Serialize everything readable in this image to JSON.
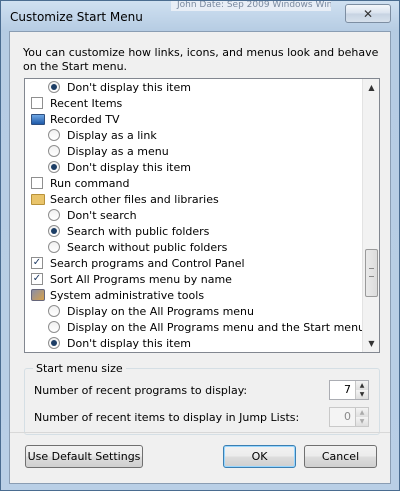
{
  "window": {
    "title": "Customize Start Menu",
    "close_glyph": "✕",
    "background_text": "John Date: Sep 2009    Windows Windows 7"
  },
  "intro": "You can customize how links, icons, and menus look and behave on the Start menu.",
  "options": [
    {
      "type": "radio",
      "label": "Don't display this item",
      "checked": true,
      "indent": 1
    },
    {
      "type": "checkbox",
      "label": "Recent Items",
      "checked": false,
      "indent": 0
    },
    {
      "type": "header",
      "label": "Recorded TV",
      "icon": "tv-icon",
      "indent": 0
    },
    {
      "type": "radio",
      "label": "Display as a link",
      "checked": false,
      "indent": 1
    },
    {
      "type": "radio",
      "label": "Display as a menu",
      "checked": false,
      "indent": 1
    },
    {
      "type": "radio",
      "label": "Don't display this item",
      "checked": true,
      "indent": 1
    },
    {
      "type": "checkbox",
      "label": "Run command",
      "checked": false,
      "indent": 0
    },
    {
      "type": "header",
      "label": "Search other files and libraries",
      "icon": "folder-icon",
      "indent": 0
    },
    {
      "type": "radio",
      "label": "Don't search",
      "checked": false,
      "indent": 1
    },
    {
      "type": "radio",
      "label": "Search with public folders",
      "checked": true,
      "indent": 1
    },
    {
      "type": "radio",
      "label": "Search without public folders",
      "checked": false,
      "indent": 1
    },
    {
      "type": "checkbox",
      "label": "Search programs and Control Panel",
      "checked": true,
      "indent": 0
    },
    {
      "type": "checkbox",
      "label": "Sort All Programs menu by name",
      "checked": true,
      "indent": 0
    },
    {
      "type": "header",
      "label": "System administrative tools",
      "icon": "tools-icon",
      "indent": 0
    },
    {
      "type": "radio",
      "label": "Display on the All Programs menu",
      "checked": false,
      "indent": 1
    },
    {
      "type": "radio",
      "label": "Display on the All Programs menu and the Start menu",
      "checked": false,
      "indent": 1
    },
    {
      "type": "radio",
      "label": "Don't display this item",
      "checked": true,
      "indent": 1
    }
  ],
  "start_menu_size": {
    "label": "Start menu size",
    "recent_programs_label": "Number of recent programs to display:",
    "recent_programs_value": "7",
    "recent_items_label": "Number of recent items to display in Jump Lists:",
    "recent_items_value": "0"
  },
  "buttons": {
    "defaults": "Use Default Settings",
    "ok": "OK",
    "cancel": "Cancel"
  },
  "glyphs": {
    "up": "▲",
    "down": "▼",
    "check": "✓"
  },
  "colors": {
    "title_bar": "#b6cce3",
    "radio_dot": "#1d3e66",
    "default_button_border": "#3c7fb1"
  }
}
